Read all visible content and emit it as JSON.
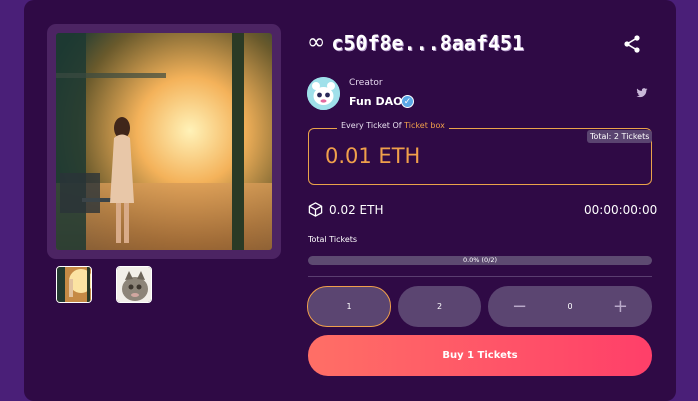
{
  "nft": {
    "title": "c50f8e...8aaf451",
    "title_icon": "infinity-icon"
  },
  "creator": {
    "label": "Creator",
    "name": "Fun DAO",
    "verified_icon": "check-icon"
  },
  "ticket": {
    "legend_prefix": "Every Ticket Of",
    "legend_accent": "Ticket box",
    "total_badge": "Total: 2 Tickets",
    "price": "0.01 ETH"
  },
  "stats": {
    "eth_amount": "0.02 ETH",
    "countdown": "00:00:00:00",
    "total_tickets_label": "Total Tickets",
    "progress_text": "0.0% (0/2)",
    "progress_fraction": 0.0
  },
  "quantity": {
    "options": [
      "1",
      "2"
    ],
    "stepper_minus": "−",
    "stepper_value": "0",
    "stepper_plus": "+"
  },
  "buy": {
    "label": "Buy 1 Tickets"
  },
  "colors": {
    "accent": "#f0a04b",
    "card_bg": "#2f0a45",
    "page_bg": "#4a1f78",
    "buy_gradient_start": "#ff6f66",
    "buy_gradient_end": "#ff3f69"
  }
}
